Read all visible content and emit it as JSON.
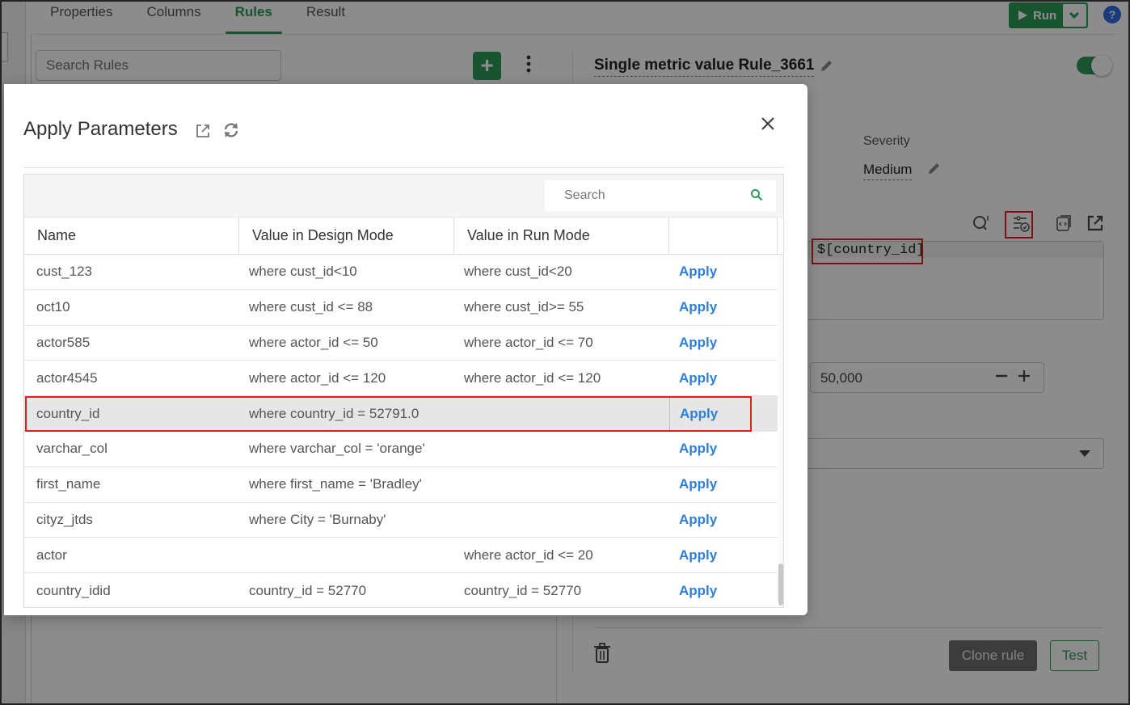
{
  "tabs": [
    {
      "label": "Properties"
    },
    {
      "label": "Columns"
    },
    {
      "label": "Rules"
    },
    {
      "label": "Result"
    }
  ],
  "toolbar": {
    "run_label": "Run",
    "help_label": "?"
  },
  "rules_panel": {
    "search_placeholder": "Search Rules",
    "add_label": "+"
  },
  "rule": {
    "title": "Single metric value Rule_3661",
    "severity_label": "Severity",
    "severity_value": "Medium",
    "expression": "$[country_id]",
    "threshold_value": "50,000",
    "clone_label": "Clone rule",
    "test_label": "Test"
  },
  "modal": {
    "title": "Apply Parameters",
    "search_placeholder": "Search",
    "columns": [
      "Name",
      "Value in Design Mode",
      "Value in Run Mode",
      ""
    ],
    "rows": [
      {
        "name": "cust_123",
        "design": "where cust_id<10",
        "run": "where cust_id<20",
        "action": "Apply"
      },
      {
        "name": "oct10",
        "design": "where cust_id <= 88",
        "run": "where cust_id>= 55",
        "action": "Apply"
      },
      {
        "name": "actor585",
        "design": "where actor_id <= 50",
        "run": "where actor_id <= 70",
        "action": "Apply"
      },
      {
        "name": "actor4545",
        "design": "where actor_id <= 120",
        "run": "where actor_id <= 120",
        "action": "Apply"
      },
      {
        "name": "country_id",
        "design": "where country_id = 52791.0",
        "run": "",
        "action": "Apply"
      },
      {
        "name": "varchar_col",
        "design": "where varchar_col = 'orange'",
        "run": "",
        "action": "Apply"
      },
      {
        "name": "first_name",
        "design": "where first_name = 'Bradley'",
        "run": "",
        "action": "Apply"
      },
      {
        "name": "cityz_jtds",
        "design": "where City = 'Burnaby'",
        "run": "",
        "action": "Apply"
      },
      {
        "name": "actor",
        "design": "",
        "run": "where actor_id <= 20",
        "action": "Apply"
      },
      {
        "name": "country_idid",
        "design": "country_id = 52770",
        "run": "country_id = 52770",
        "action": "Apply"
      }
    ]
  },
  "colors": {
    "accent": "#2e9a5a",
    "link": "#2f7fd8",
    "highlight": "#e02020"
  },
  "icons": [
    "play-icon",
    "chevron-down-icon",
    "help-icon",
    "plus-icon",
    "kebab-icon",
    "pencil-icon",
    "query-icon",
    "parameters-icon",
    "code-icon",
    "external-link-icon",
    "refresh-icon",
    "close-icon",
    "search-icon",
    "trash-icon",
    "minus-icon"
  ]
}
